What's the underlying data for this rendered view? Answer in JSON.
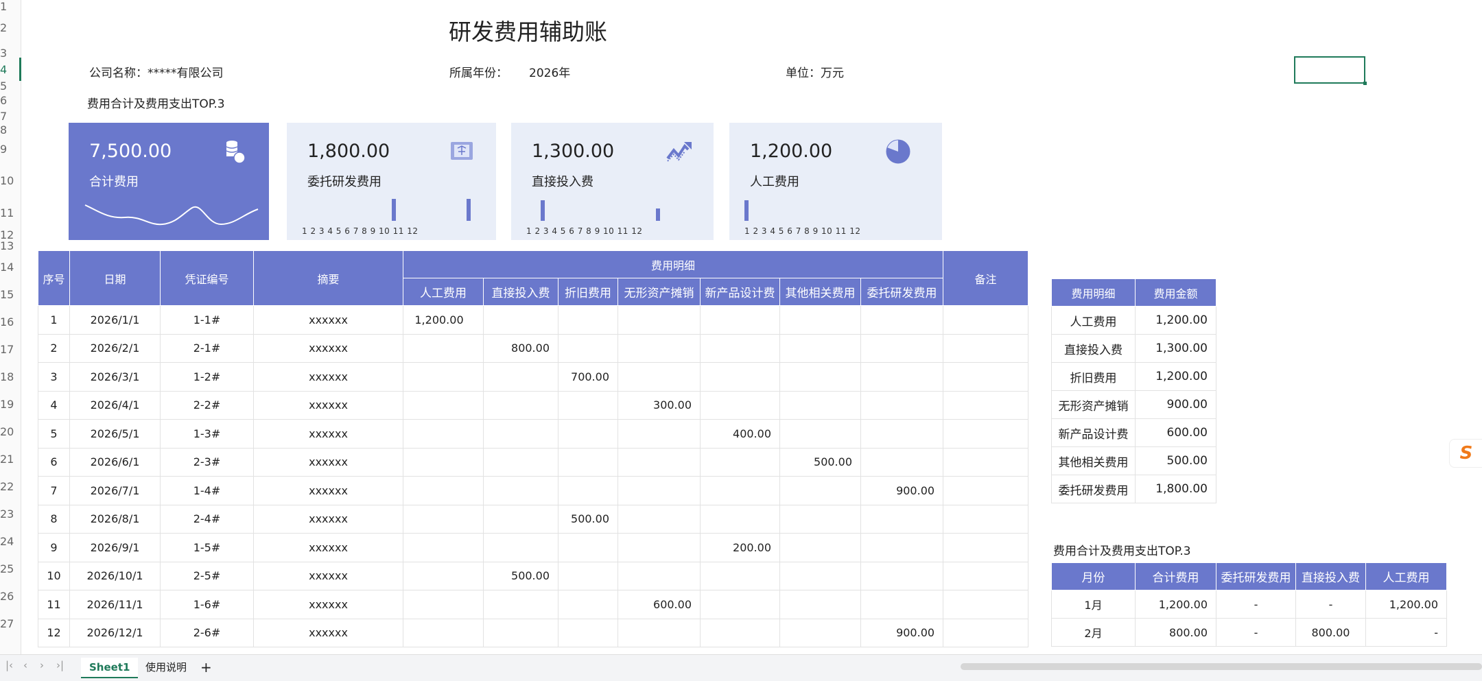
{
  "row_headers": [
    "1",
    "2",
    "3",
    "4",
    "5",
    "6",
    "7",
    "8",
    "9",
    "10",
    "11",
    "12",
    "13",
    "14",
    "15",
    "16",
    "17",
    "18",
    "19",
    "20",
    "21",
    "22",
    "23",
    "24",
    "25",
    "26",
    "27"
  ],
  "title": "研发费用辅助账",
  "company_label": "公司名称：*****有限公司",
  "year_label": "所属年份：",
  "year_value": "2026年",
  "unit_label": "单位：万元",
  "section_title": "费用合计及费用支出TOP.3",
  "cards": [
    {
      "value": "7,500.00",
      "label": "合计费用",
      "icon": "coins-stack-icon"
    },
    {
      "value": "1,800.00",
      "label": "委托研发费用",
      "icon": "document-cert-icon",
      "axis": "1 2 3 4 5 6 7 8 9 10 11 12",
      "bars": [
        0,
        0,
        0,
        0,
        0,
        0,
        0.7,
        0,
        0,
        0,
        0,
        0.7
      ]
    },
    {
      "value": "1,300.00",
      "label": "直接投入费",
      "icon": "trend-chart-icon",
      "axis": "1 2 3 4 5 6 7 8 9 10 11 12",
      "bars": [
        0,
        0.65,
        0,
        0,
        0,
        0,
        0,
        0,
        0,
        0.4,
        0,
        0
      ]
    },
    {
      "value": "1,200.00",
      "label": "人工费用",
      "icon": "pie-chart-icon",
      "axis": "1 2 3 4 5 6 7 8 9 10 11 12",
      "bars": [
        0.65,
        0,
        0,
        0,
        0,
        0,
        0,
        0,
        0,
        0,
        0,
        0
      ]
    }
  ],
  "main_table": {
    "headers": {
      "seq": "序号",
      "date": "日期",
      "voucher": "凭证编号",
      "summary": "摘要",
      "detail": "费用明细",
      "note": "备注"
    },
    "sub_headers": [
      "人工费用",
      "直接投入费",
      "折旧费用",
      "无形资产摊销",
      "新产品设计费",
      "其他相关费用",
      "委托研发费用"
    ],
    "rows": [
      {
        "seq": "1",
        "date": "2026/1/1",
        "voucher": "1-1#",
        "summary": "xxxxxx",
        "cells": [
          "1,200.00",
          "",
          "",
          "",
          "",
          "",
          ""
        ]
      },
      {
        "seq": "2",
        "date": "2026/2/1",
        "voucher": "2-1#",
        "summary": "xxxxxx",
        "cells": [
          "",
          "800.00",
          "",
          "",
          "",
          "",
          ""
        ]
      },
      {
        "seq": "3",
        "date": "2026/3/1",
        "voucher": "1-2#",
        "summary": "xxxxxx",
        "cells": [
          "",
          "",
          "700.00",
          "",
          "",
          "",
          ""
        ]
      },
      {
        "seq": "4",
        "date": "2026/4/1",
        "voucher": "2-2#",
        "summary": "xxxxxx",
        "cells": [
          "",
          "",
          "",
          "300.00",
          "",
          "",
          ""
        ]
      },
      {
        "seq": "5",
        "date": "2026/5/1",
        "voucher": "1-3#",
        "summary": "xxxxxx",
        "cells": [
          "",
          "",
          "",
          "",
          "400.00",
          "",
          ""
        ]
      },
      {
        "seq": "6",
        "date": "2026/6/1",
        "voucher": "2-3#",
        "summary": "xxxxxx",
        "cells": [
          "",
          "",
          "",
          "",
          "",
          "500.00",
          ""
        ]
      },
      {
        "seq": "7",
        "date": "2026/7/1",
        "voucher": "1-4#",
        "summary": "xxxxxx",
        "cells": [
          "",
          "",
          "",
          "",
          "",
          "",
          "900.00"
        ]
      },
      {
        "seq": "8",
        "date": "2026/8/1",
        "voucher": "2-4#",
        "summary": "xxxxxx",
        "cells": [
          "",
          "",
          "500.00",
          "",
          "",
          "",
          ""
        ]
      },
      {
        "seq": "9",
        "date": "2026/9/1",
        "voucher": "1-5#",
        "summary": "xxxxxx",
        "cells": [
          "",
          "",
          "",
          "",
          "200.00",
          "",
          ""
        ]
      },
      {
        "seq": "10",
        "date": "2026/10/1",
        "voucher": "2-5#",
        "summary": "xxxxxx",
        "cells": [
          "",
          "500.00",
          "",
          "",
          "",
          "",
          ""
        ]
      },
      {
        "seq": "11",
        "date": "2026/11/1",
        "voucher": "1-6#",
        "summary": "xxxxxx",
        "cells": [
          "",
          "",
          "",
          "600.00",
          "",
          "",
          ""
        ]
      },
      {
        "seq": "12",
        "date": "2026/12/1",
        "voucher": "2-6#",
        "summary": "xxxxxx",
        "cells": [
          "",
          "",
          "",
          "",
          "",
          "",
          "900.00"
        ]
      }
    ]
  },
  "summary_table": {
    "headers": [
      "费用明细",
      "费用金额"
    ],
    "rows": [
      [
        "人工费用",
        "1,200.00"
      ],
      [
        "直接投入费",
        "1,300.00"
      ],
      [
        "折旧费用",
        "1,200.00"
      ],
      [
        "无形资产摊销",
        "900.00"
      ],
      [
        "新产品设计费",
        "600.00"
      ],
      [
        "其他相关费用",
        "500.00"
      ],
      [
        "委托研发费用",
        "1,800.00"
      ]
    ]
  },
  "top3_title": "费用合计及费用支出TOP.3",
  "top3_table": {
    "headers": [
      "月份",
      "合计费用",
      "委托研发费用",
      "直接投入费",
      "人工费用"
    ],
    "rows": [
      [
        "1月",
        "1,200.00",
        "-",
        "-",
        "1,200.00"
      ],
      [
        "2月",
        "800.00",
        "-",
        "800.00",
        "-"
      ]
    ]
  },
  "sheet_tabs": {
    "active": "Sheet1",
    "other": "使用说明",
    "add": "+"
  },
  "nav_arrows": [
    "|‹",
    "‹",
    "›",
    "›|"
  ],
  "ime_label": "S"
}
